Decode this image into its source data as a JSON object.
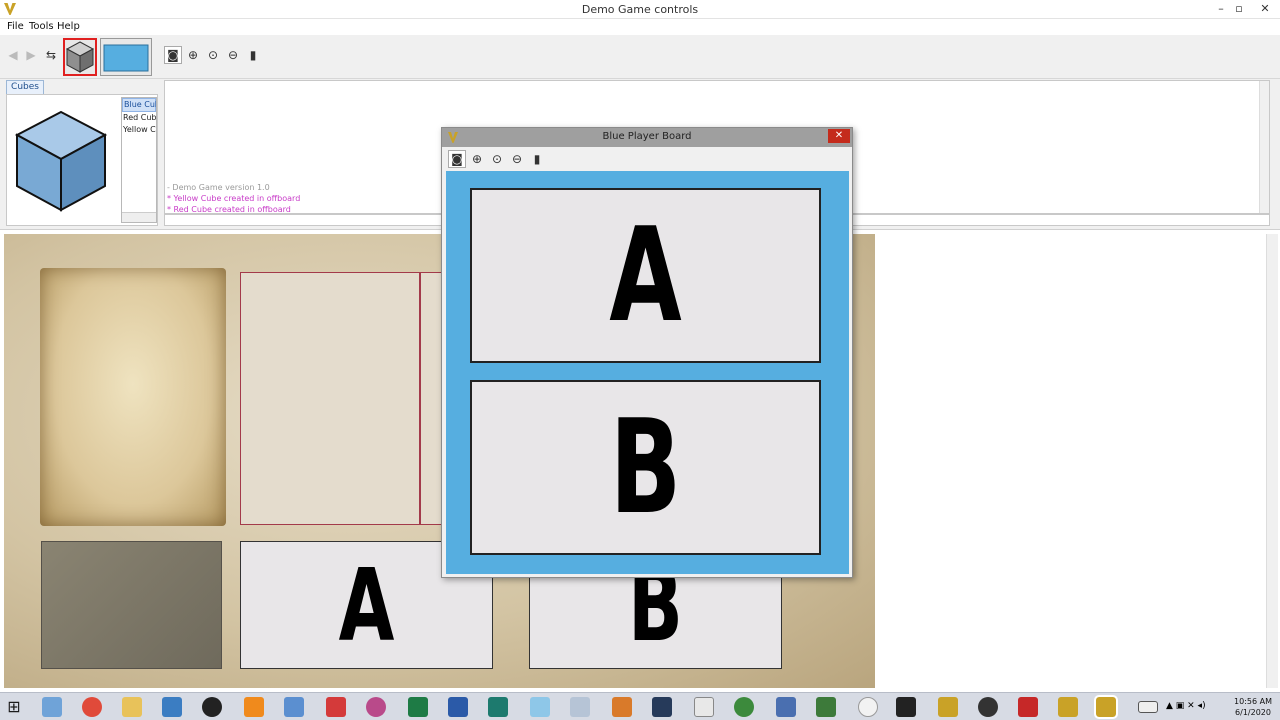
{
  "window": {
    "title": "Demo Game controls"
  },
  "menu": {
    "items": [
      "File",
      "Tools",
      "Help"
    ]
  },
  "palette": {
    "tab": "Cubes",
    "items": [
      "Blue Cube",
      "Red Cube",
      "Yellow Cube"
    ],
    "selected": "Blue Cube",
    "cube_color": "#79a9d4"
  },
  "chat": {
    "lines": [
      {
        "text": "- Demo Game version 1.0",
        "color": "#9a9a9a"
      },
      {
        "text": "* Yellow Cube created in offboard",
        "color": "#c83cc8"
      },
      {
        "text": "* Red Cube created in offboard",
        "color": "#c83cc8"
      }
    ]
  },
  "map": {
    "cards": [
      "A",
      "B"
    ]
  },
  "dialog": {
    "title": "Blue Player Board",
    "cards": [
      "A",
      "B"
    ],
    "board_color": "#56aee0"
  },
  "taskbar": {
    "time": "10:56 AM",
    "date": "6/1/2020"
  }
}
